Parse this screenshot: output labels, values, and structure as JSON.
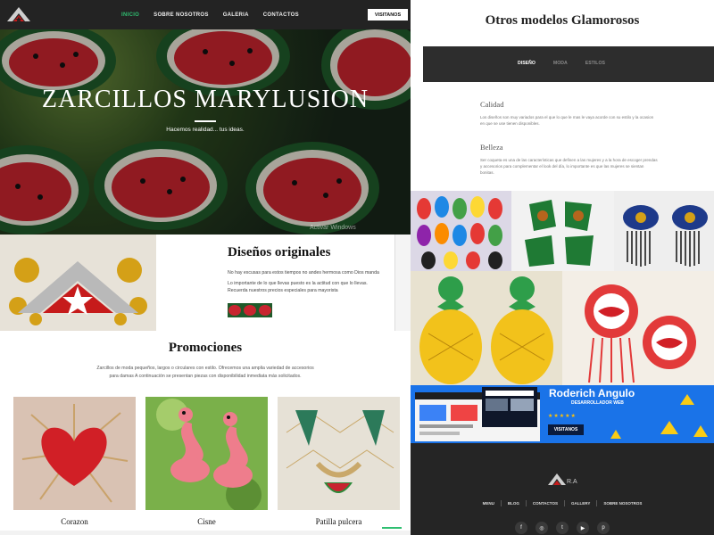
{
  "nav": {
    "items": [
      "INICIO",
      "SOBRE NOSOTROS",
      "GALERIA",
      "CONTACTOS"
    ],
    "active": "INICIO",
    "visit_label": "VISITANOS"
  },
  "hero": {
    "title": "ZARCILLOS MARYLUSION",
    "subtitle": "Hacemos realidad... tus ideas.",
    "watermark": "Activar Windows"
  },
  "disenos": {
    "title": "Diseños originales",
    "p1": "No hay excusas para estos tiempos no andes hermosa como Dios manda",
    "p2": "Lo importante de lo que llevas puesto es la actitud con que lo llevas. Recuerda nuestros precios especiales para mayorista"
  },
  "promociones": {
    "title": "Promociones",
    "text": "Zarcillos de moda pequeños, largos o circulares con estilo. Ofrecemos una amplia variedad de accesorios para damas A continuación se presentan piezas con disponibilidad inmediata más solicitados.",
    "cards": [
      {
        "label": "Corazon"
      },
      {
        "label": "Cisne"
      },
      {
        "label": "Patilla pulcera"
      }
    ]
  },
  "right": {
    "title": "Otros modelos Glamorosos",
    "tabs": [
      "DISEÑO",
      "MODA",
      "ESTILOS"
    ],
    "active_tab": "DISEÑO",
    "section1_title": "Calidad",
    "section1_text": "Los diseños son muy variados para el que lo que le mas le vaya acorde con su estilo y la ocasion en que se use tienen disponibles.",
    "section2_title": "Belleza",
    "section2_text": "Ser coqueta es una de las características que definen a las mujeres y a la hora de escoger prendas y accesorios para complementar el look del día, lo importante es que las mujeres se sientan bonitas."
  },
  "banner": {
    "name": "Roderich Angulo",
    "role": "DESARROLLADOR WEB",
    "stars": "★★★★★",
    "button": "VISITANOS"
  },
  "footer": {
    "logo_text": "R.A",
    "links": [
      "MENU",
      "BLOG",
      "CONTACTOS",
      "GALLERY",
      "SOBRE NOSOTROS"
    ],
    "socials": [
      "facebook-icon",
      "instagram-icon",
      "twitter-icon",
      "youtube-icon",
      "pinterest-icon"
    ]
  },
  "colors": {
    "nav_bg": "#232323",
    "accent_green": "#2fbf71",
    "banner_blue": "#1a73e8",
    "footer_bg": "#252525"
  }
}
